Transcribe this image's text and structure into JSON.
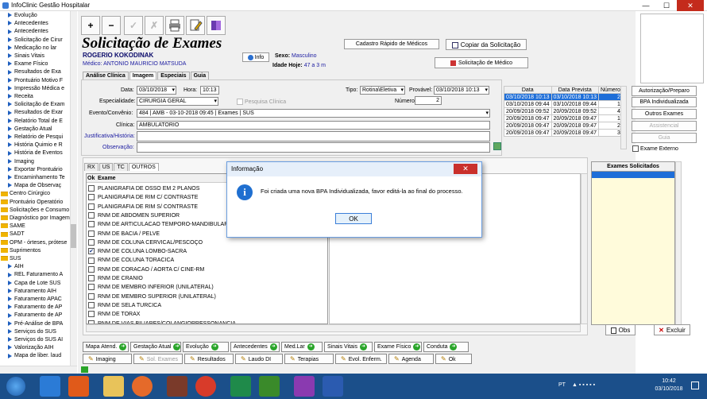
{
  "window": {
    "title": "InfoClinic Gestão Hospitalar",
    "min": "—",
    "max": "☐",
    "close": "✕"
  },
  "tree": [
    {
      "label": "Evolução",
      "type": "item"
    },
    {
      "label": "Antecedentes",
      "type": "item"
    },
    {
      "label": "Antecedentes",
      "type": "item"
    },
    {
      "label": "Solicitação de Cirur",
      "type": "item"
    },
    {
      "label": "Medicação no lar",
      "type": "item"
    },
    {
      "label": "Sinais Vitais",
      "type": "item"
    },
    {
      "label": "Exame Físico",
      "type": "item"
    },
    {
      "label": "Resultados de Exa",
      "type": "item"
    },
    {
      "label": "Prontuário Motivo F",
      "type": "item"
    },
    {
      "label": "Impressão Médica e",
      "type": "item"
    },
    {
      "label": "Receita",
      "type": "item"
    },
    {
      "label": "Solicitação de Exam",
      "type": "item"
    },
    {
      "label": "Resultados de Exar",
      "type": "item"
    },
    {
      "label": "Relatório Total de E",
      "type": "item"
    },
    {
      "label": "Gestação Atual",
      "type": "item"
    },
    {
      "label": "Relatório de Pesqui",
      "type": "item"
    },
    {
      "label": "História Quimio e R",
      "type": "item"
    },
    {
      "label": "História de Eventos",
      "type": "item"
    },
    {
      "label": "Imaging",
      "type": "item"
    },
    {
      "label": "Exportar Prontuário",
      "type": "item"
    },
    {
      "label": "Encaminhamento Te",
      "type": "item"
    },
    {
      "label": "Mapa de Observaç",
      "type": "item"
    },
    {
      "label": "Centro Cirúrgico",
      "type": "folder"
    },
    {
      "label": "Prontuário Operatório",
      "type": "folder"
    },
    {
      "label": "Solicitações e Consumo",
      "type": "folder"
    },
    {
      "label": "Diagnóstico por Imagem",
      "type": "folder"
    },
    {
      "label": "SAME",
      "type": "folder"
    },
    {
      "label": "SADT",
      "type": "folder"
    },
    {
      "label": "OPM - órteses, prótese",
      "type": "folder"
    },
    {
      "label": "Suprimentos",
      "type": "folder"
    },
    {
      "label": "SUS",
      "type": "folder"
    },
    {
      "label": "AIH",
      "type": "item"
    },
    {
      "label": "REL Faturamento A",
      "type": "item"
    },
    {
      "label": "Capa de Lote SUS",
      "type": "item"
    },
    {
      "label": "Faturamento AIH",
      "type": "item"
    },
    {
      "label": "Faturamento APAC",
      "type": "item"
    },
    {
      "label": "Faturamento de AP",
      "type": "item"
    },
    {
      "label": "Faturamento de AP",
      "type": "item"
    },
    {
      "label": "Pré-Análise de BPA",
      "type": "item"
    },
    {
      "label": "Serviços do SUS",
      "type": "item"
    },
    {
      "label": "Serviços do SUS AI",
      "type": "item"
    },
    {
      "label": "Valorização AIH",
      "type": "item"
    },
    {
      "label": "Mapa de liber. laud",
      "type": "item"
    }
  ],
  "toolbar": {
    "add": "+",
    "remove": "−",
    "check": "✓",
    "cancel": "✗"
  },
  "header": {
    "title": "Solicitação de Exames",
    "patient": "ROGERIO KOKODINAK",
    "medico_label": "Médico:",
    "medico": "ANTONIO MAURICIO MATSUDA",
    "info_label": "Info",
    "sexo_label": "Sexo:",
    "sexo": "Masculino",
    "idade_label": "Idade Hoje:",
    "idade": "47 a 3 m",
    "cadastro_btn": "Cadastro Rápido de Médicos",
    "copiar_btn": "Copiar da Solicitação",
    "solicitacao_medico_btn": "Solicitação de Médico"
  },
  "tabs": [
    "Análise Clínica",
    "Imagem",
    "Especiais",
    "Guia"
  ],
  "form": {
    "data_label": "Data:",
    "data": "03/10/2018",
    "hora_label": "Hora:",
    "hora": "10:13",
    "tipo_label": "Tipo:",
    "tipo": "Rotina\\Eletiva",
    "provavel_label": "Provável:",
    "provavel": "03/10/2018 10:13",
    "especialidade_label": "Especialidade:",
    "especialidade": "CIRURGIA GERAL",
    "pesquisa_label": "Pesquisa Clínica",
    "numero_label": "Número:",
    "numero": "2",
    "evento_label": "Evento/Convênio:",
    "evento": "484 | AMB - 03-10-2018 09:45 | Exames | SUS",
    "clinica_label": "Clínica:",
    "clinica": "AMBULATORIO",
    "justificativa_label": "Justificativa/História:",
    "observacao_label": "Observação:"
  },
  "history": {
    "headers": [
      "Data",
      "Data Prevista",
      "Número"
    ],
    "rows": [
      [
        "03/10/2018 10:13",
        "03/10/2018 10:13",
        "2"
      ],
      [
        "03/10/2018 09:44",
        "03/10/2018 09:44",
        "1"
      ],
      [
        "20/09/2018 09:52",
        "20/09/2018 09:52",
        "4"
      ],
      [
        "20/09/2018 09:47",
        "20/09/2018 09:47",
        "1"
      ],
      [
        "20/09/2018 09:47",
        "20/09/2018 09:47",
        "2"
      ],
      [
        "20/09/2018 09:47",
        "20/09/2018 09:47",
        "3"
      ]
    ]
  },
  "right_buttons": {
    "autorizacao": "Autorização/Preparo",
    "bpa": "BPA Individualizada",
    "outros": "Outros Exames",
    "assistencial": "Assistencial",
    "guia": "Guia",
    "externo": "Exame Externo"
  },
  "subtabs": [
    "RX",
    "US",
    "TC",
    "OUTROS"
  ],
  "exam_list": {
    "headers": [
      "Ok",
      "Exame"
    ],
    "items": [
      {
        "name": "PLANIGRAFIA DE OSSO EM 2 PLANOS",
        "checked": false
      },
      {
        "name": "PLANIGRAFIA DE RIM C/ CONTRASTE",
        "checked": false
      },
      {
        "name": "PLANIGRAFIA DE RIM S/ CONTRASTE",
        "checked": false
      },
      {
        "name": "RNM  DE ABDOMEN SUPERIOR",
        "checked": false
      },
      {
        "name": "RNM  DE ARTICULACAO TEMPORO-MANDIBULAR (BILATERAL)",
        "checked": false
      },
      {
        "name": "RNM  DE BACIA / PELVE",
        "checked": false
      },
      {
        "name": "RNM  DE COLUNA CERVICAL/PESCOÇO",
        "checked": false
      },
      {
        "name": "RNM  DE COLUNA LOMBO-SACRA",
        "checked": true
      },
      {
        "name": "RNM  DE COLUNA TORACICA",
        "checked": false
      },
      {
        "name": "RNM  DE CORACAO / AORTA C/ CINE-RM",
        "checked": false
      },
      {
        "name": "RNM  DE CRANIO",
        "checked": false
      },
      {
        "name": "RNM  DE MEMBRO INFERIOR (UNILATERAL)",
        "checked": false
      },
      {
        "name": "RNM  DE MEMBRO SUPERIOR (UNILATERAL)",
        "checked": false
      },
      {
        "name": "RNM  DE SELA TURCICA",
        "checked": false
      },
      {
        "name": "RNM  DE TORAX",
        "checked": false
      },
      {
        "name": "RNM  DE VIAS BILIARES/COLANGIORRESSONANCIA",
        "checked": false
      }
    ]
  },
  "solicitados": {
    "title": "Exames Solicitados",
    "obs": "Obs",
    "excluir": "Excluir"
  },
  "dialog": {
    "title": "Informação",
    "message": "Foi criada uma nova BPA Individualizada, favor editá-la ao final do processo.",
    "ok": "OK",
    "close": "✕"
  },
  "bottom_row1": [
    "Mapa Atend.",
    "Gestação Atual",
    "Evolução",
    "Antecedentes",
    "Med.Lar",
    "Sinais Vitais",
    "Exame Físico",
    "Conduta"
  ],
  "bottom_row2": [
    "Imaging",
    "Sol. Exames",
    "Resultados",
    "Laudo DI",
    "Terapias",
    "Evol. Enferm.",
    "Agenda",
    "Ok"
  ],
  "taskbar": {
    "lang": "PT",
    "time": "10:42",
    "date": "03/10/2018"
  },
  "colors": {
    "selection": "#1e6ed8",
    "taskbar": "#1b4f8a",
    "solicitados_bg": "#fffbdb"
  }
}
